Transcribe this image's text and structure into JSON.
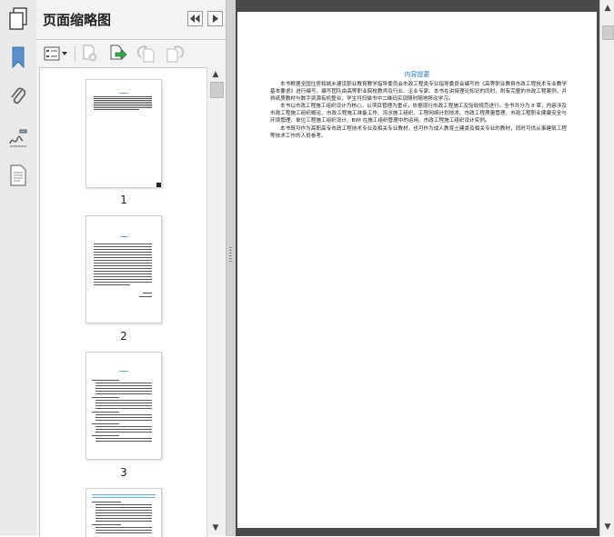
{
  "panel": {
    "title": "页面缩略图"
  },
  "thumbnails": [
    {
      "label": "1"
    },
    {
      "label": "2"
    },
    {
      "label": "3"
    },
    {
      "label": ""
    }
  ],
  "document": {
    "heading": "内容提要",
    "paragraphs": [
      "本书根据全国住房和城乡建设职业教育教学指导委员会市政工程类专业指导委员会编写的《高等职业教育市政工程技术专业教学基本要求》进行编写。编写团队由高等职业院校教师及行业、企业专家。本书在讲授理论知识的同时，附有完整的市政工程案例，并将纸质教材与数字资源有机整合，学生可扫描书中二维码实现随时随地移动学习。",
      "本书以市政工程施工组织设计为核心，以项目管理为重点，依据现行市政工程施工及验收规范进行。全书共分为 8 章，内容涉及市政工程施工组织概论、市政工程施工准备工作、流水施工组织、工程网络计划技术、市政工程质量管理、市政工程职业健康安全与环境管理、单位工程施工组织设计、BIM 在施工组织管理中的运用、市政工程施工组织设计实例。",
      "本书既可作为高职高专市政工程技术专业及相关专业教材，也可作为成人教育土建类及相关专业的教材，同时可供从事建筑工程等技术工作的人员参考。"
    ]
  },
  "icons": {
    "rail": [
      "pages-icon",
      "bookmark-icon",
      "attachment-icon",
      "signature-icon",
      "document-properties-icon"
    ],
    "toolbar": [
      "thumbnail-options-icon",
      "delete-page-icon",
      "insert-page-icon",
      "rotate-counterclockwise-icon",
      "rotate-clockwise-icon"
    ]
  },
  "colors": {
    "accent_blue": "#2a7bc4",
    "doc_background": "#4a4a4a",
    "panel_background": "#f3f3f3"
  }
}
